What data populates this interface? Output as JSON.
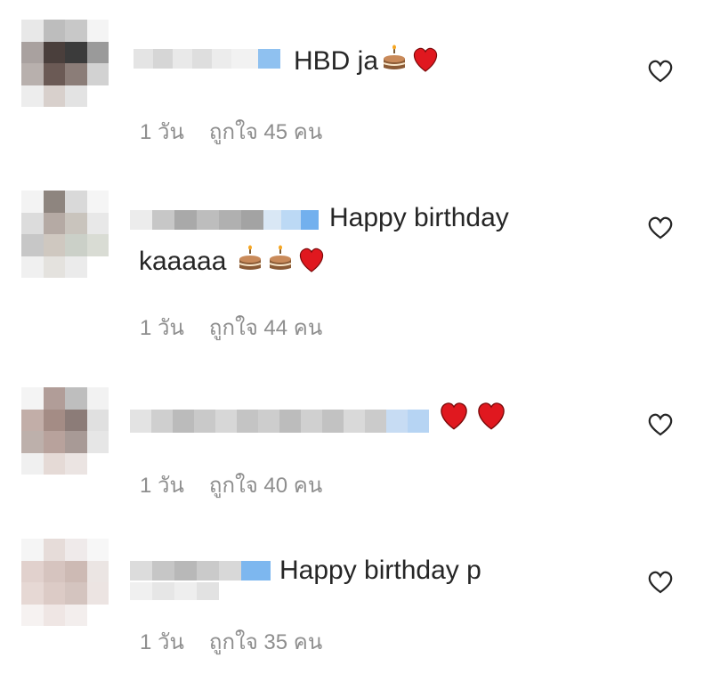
{
  "comments": [
    {
      "text_line1": "HBD ja",
      "text_line2": "",
      "emojis": [
        "birthday-cake",
        "red-heart"
      ],
      "time": "1 วัน",
      "likes": "ถูกใจ 45 คน"
    },
    {
      "text_line1": "Happy birthday",
      "text_line2": "kaaaaa",
      "emojis": [
        "birthday-cake",
        "birthday-cake",
        "red-heart"
      ],
      "time": "1 วัน",
      "likes": "ถูกใจ 44 คน"
    },
    {
      "text_line1": "",
      "text_line2": "",
      "emojis": [
        "red-heart",
        "red-heart"
      ],
      "time": "1 วัน",
      "likes": "ถูกใจ 40 คน"
    },
    {
      "text_line1": "Happy birthday p",
      "text_line2": "",
      "emojis": [],
      "time": "1 วัน",
      "likes": "ถูกใจ 35 คน"
    }
  ],
  "icons": {
    "like_button": "heart-outline-icon",
    "verified_badge": "blue-verified-icon"
  },
  "colors": {
    "text": "#262626",
    "meta": "#8e8e8e",
    "heart": "#e0181f",
    "badge": "#6fb2ef"
  }
}
